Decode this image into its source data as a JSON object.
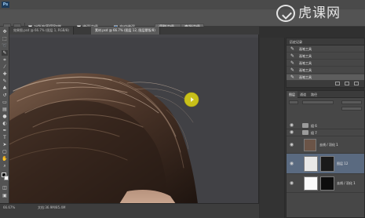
{
  "watermark": {
    "text": "虎课网"
  },
  "options_bar": {
    "sample_all_layers": "对所有图层取样",
    "enhance_edge": "增强边缘",
    "auto_enhance": "自动增强",
    "refine_button": "调整边缘...",
    "subtract_button": "查找边缘"
  },
  "tabs": [
    {
      "label": "效果图.psd @ 66.7% (图层 1, RGB/8)"
    },
    {
      "label": "素材.psd @ 66.7% (图层 12, 图层蒙版/8)"
    }
  ],
  "history": {
    "title": "历史记录",
    "items": [
      {
        "label": "画笔工具"
      },
      {
        "label": "画笔工具"
      },
      {
        "label": "画笔工具"
      },
      {
        "label": "画笔工具"
      },
      {
        "label": "画笔工具"
      }
    ]
  },
  "layers": {
    "tabs": [
      "图层",
      "通道",
      "路径"
    ],
    "rows": [
      {
        "name": "组 6"
      },
      {
        "name": "组 7"
      },
      {
        "name": "去线 / 羽化 1"
      },
      {
        "name": "图层 12"
      },
      {
        "name": "去线 / 羽化 1"
      }
    ]
  },
  "status": {
    "zoom": "66.67%",
    "doc": "文档:36.9M/85.4M"
  },
  "colors": {
    "brush_cursor": "#c8c019",
    "canvas_bg": "#414145",
    "panel_bg": "#474747"
  }
}
